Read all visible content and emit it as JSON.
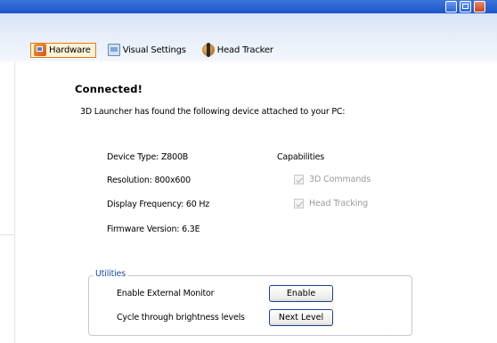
{
  "window": {
    "title_buttons": [
      "minimize-icon",
      "maximize-icon",
      "close-icon"
    ]
  },
  "tabs": [
    {
      "label": "Hardware",
      "icon": "hardware-icon",
      "active": true
    },
    {
      "label": "Visual Settings",
      "icon": "visual-settings-icon",
      "active": false
    },
    {
      "label": "Head Tracker",
      "icon": "head-tracker-icon",
      "active": false
    }
  ],
  "status": {
    "heading": "Connected!",
    "message": "3D Launcher has found the following device attached to your PC:"
  },
  "device": {
    "type": "Device Type: Z800B",
    "resolution": "Resolution: 800x600",
    "frequency": "Display Frequency: 60 Hz",
    "firmware": "Firmware Version: 6.3E"
  },
  "capabilities": {
    "title": "Capabilities",
    "items": [
      {
        "label": "3D Commands",
        "checked": true,
        "enabled": false
      },
      {
        "label": "Head Tracking",
        "checked": true,
        "enabled": false
      }
    ]
  },
  "utilities": {
    "legend": "Utilities",
    "external_monitor_label": "Enable External Monitor",
    "external_monitor_button": "Enable",
    "brightness_label": "Cycle through brightness levels",
    "brightness_button": "Next Level"
  },
  "colors": {
    "titlebar": "#1c55c8",
    "active_tab_border": "#e6791e",
    "group_legend": "#1f4aa8"
  }
}
